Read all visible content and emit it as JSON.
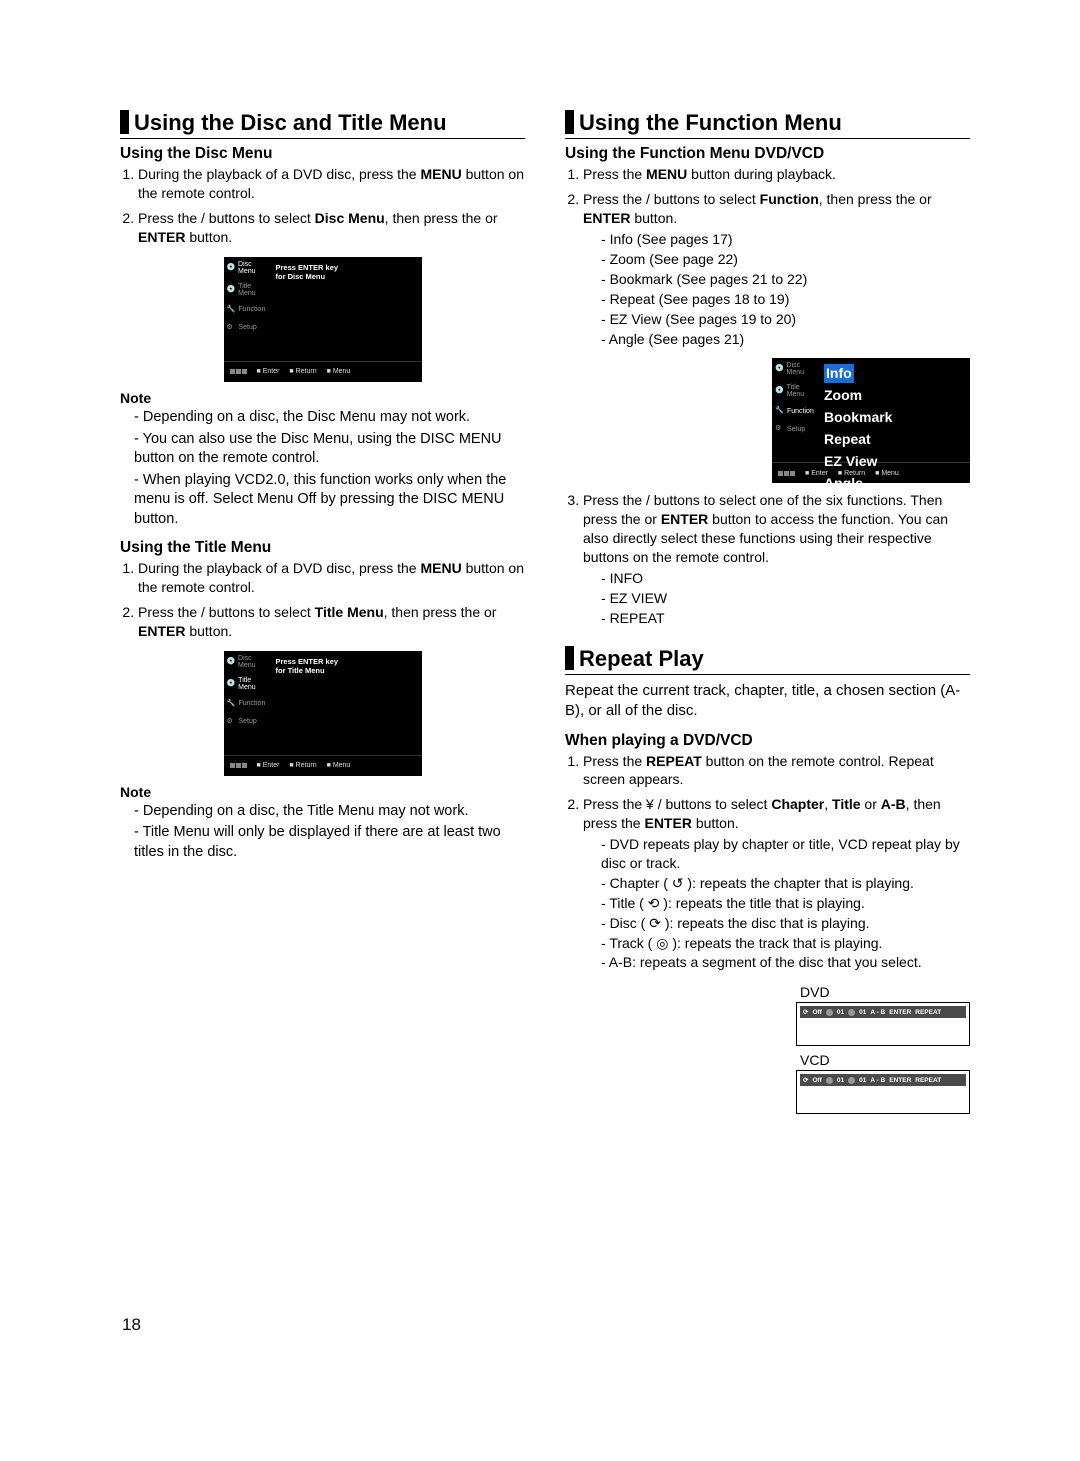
{
  "page_number": "18",
  "col_left": {
    "h1": "Using the Disc and Title Menu",
    "sec1": {
      "h2": "Using the Disc Menu",
      "step1_a": "During the playback of a DVD disc, press the ",
      "step1_bold": "MENU",
      "step1_b": " button on the remote control.",
      "step2_a": "Press the    /    buttons to select ",
      "step2_bold": "Disc Menu",
      "step2_b": ", then press the    or ",
      "step2_bold2": "ENTER",
      "step2_c": " button.",
      "osd": {
        "side": [
          "Disc Menu",
          "Title Menu",
          "Function",
          "Setup"
        ],
        "main1": "Press ENTER key",
        "main2": "for Disc Menu",
        "foot": [
          "Enter",
          "Return",
          "Menu"
        ]
      },
      "note_label": "Note",
      "notes": [
        "Depending on a disc, the Disc Menu may not work.",
        "You can also use the Disc Menu, using the DISC MENU button on the remote control.",
        "When playing VCD2.0, this function works only when the menu is off. Select Menu Off by pressing the DISC MENU button."
      ]
    },
    "sec2": {
      "h2": "Using the Title Menu",
      "step1_a": "During the playback of a DVD disc, press the ",
      "step1_bold": "MENU",
      "step1_b": " button on the remote control.",
      "step2_a": "Press the    /    buttons to select ",
      "step2_bold": "Title Menu",
      "step2_b": ", then press the    or ",
      "step2_bold2": "ENTER",
      "step2_c": " button.",
      "osd": {
        "side": [
          "Disc Menu",
          "Title Menu",
          "Function",
          "Setup"
        ],
        "main1": "Press ENTER key",
        "main2": "for Title Menu",
        "foot": [
          "Enter",
          "Return",
          "Menu"
        ]
      },
      "note_label": "Note",
      "notes": [
        "Depending on a disc, the Title Menu may not work.",
        "Title Menu will only be displayed if there are at least two titles in the disc."
      ]
    }
  },
  "col_right": {
    "h1a": "Using the Function Menu",
    "sec1": {
      "h2": "Using the Function Menu DVD/VCD",
      "step1_a": "Press the ",
      "step1_bold": "MENU",
      "step1_b": " button during playback.",
      "step2_a": "Press the    /    buttons to select ",
      "step2_bold": "Function",
      "step2_b": ", then press the    or ",
      "step2_bold2": "ENTER",
      "step2_c": " button.",
      "sublist": [
        "Info (See pages 17)",
        "Zoom (See page 22)",
        "Bookmark (See pages 21 to 22)",
        "Repeat (See pages 18 to 19)",
        "EZ View (See pages 19 to 20)",
        "Angle (See pages 21)"
      ],
      "osd": {
        "side": [
          "Disc Menu",
          "Title Menu",
          "Function",
          "Setup"
        ],
        "list": [
          "Info",
          "Zoom",
          "Bookmark",
          "Repeat",
          "EZ View",
          "Angle"
        ],
        "foot": [
          "Enter",
          "Return",
          "Menu"
        ]
      },
      "step3_a": "Press the    /    buttons to select one of the six functions. Then press the     or ",
      "step3_bold": "ENTER",
      "step3_b": " button to access the function. You can also directly select these functions using their respective buttons on the remote control.",
      "sublist2": [
        "INFO",
        "EZ VIEW",
        "REPEAT"
      ]
    },
    "h1b": "Repeat Play",
    "sec2": {
      "intro": "Repeat the current track, chapter, title, a chosen section (A-B), or all of the disc.",
      "h2": "When playing a DVD/VCD",
      "step1_a": "Press the ",
      "step1_bold": "REPEAT",
      "step1_b": " button on the remote control. Repeat screen appears.",
      "step2_a": "Press the  ¥ /    buttons to select ",
      "step2_bold1": "Chapter",
      "step2_mid": ", ",
      "step2_bold2": "Title",
      "step2_mid2": " or ",
      "step2_bold3": "A-B",
      "step2_b": ", then press the ",
      "step2_bold4": "ENTER",
      "step2_c": " button.",
      "sublist": [
        "DVD repeats play by chapter or title, VCD repeat play by disc or track.",
        "Chapter ( ↺ ): repeats the chapter that is playing.",
        "Title ( ⟲ ): repeats the title that is playing.",
        "Disc ( ⟳ ): repeats the disc that is playing.",
        "Track ( ◎ ): repeats the track that is playing.",
        "A-B: repeats a segment of the disc that you select."
      ],
      "rep_dvd_label": "DVD",
      "rep_vcd_label": "VCD",
      "rep_bar": {
        "off": "Off",
        "n1": "01",
        "n2": "01",
        "ab": "A - B",
        "enter": "ENTER",
        "repeat": "REPEAT"
      }
    }
  }
}
